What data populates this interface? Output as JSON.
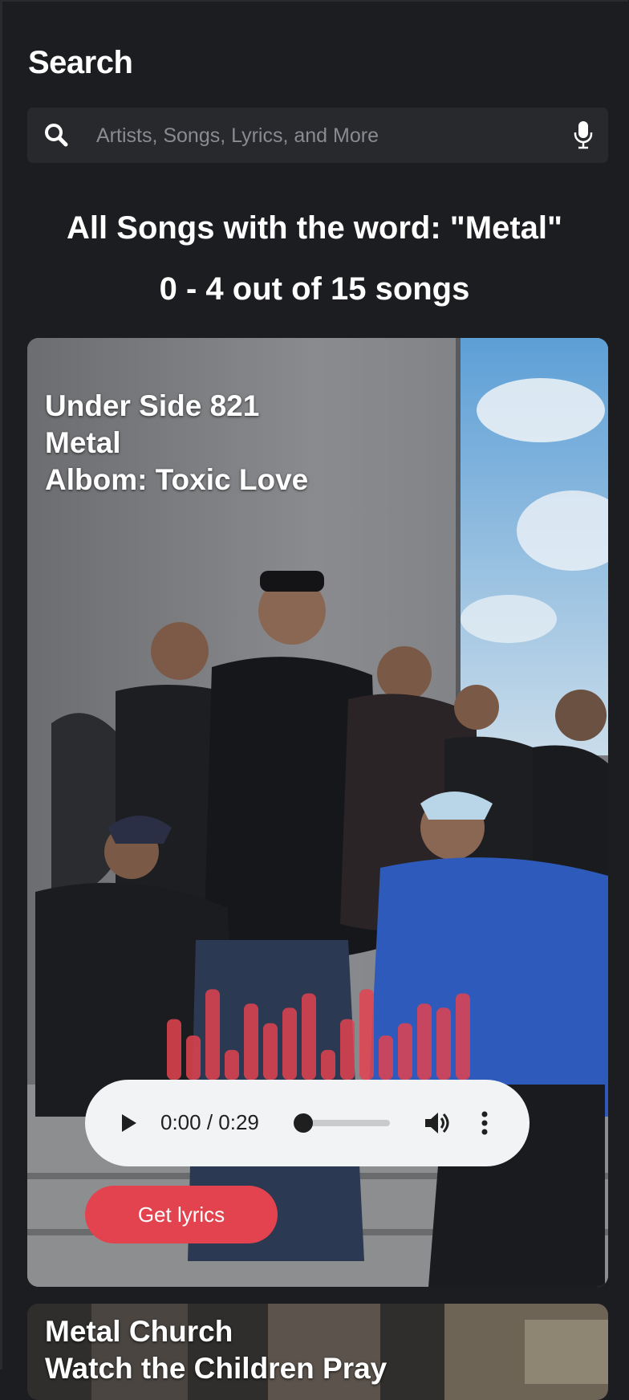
{
  "header": {
    "title": "Search"
  },
  "search": {
    "placeholder": "Artists, Songs, Lyrics, and More"
  },
  "results": {
    "heading": "All Songs with the word: \"Metal\"",
    "count": "0 - 4 out of 15 songs"
  },
  "songs": [
    {
      "artist": "Under Side 821",
      "title": "Metal",
      "album": "Albom: Toxic Love",
      "player": {
        "time": "0:00 / 0:29",
        "progress": 0
      },
      "lyrics_button": "Get lyrics",
      "visualizer_levels": [
        0.59,
        0.43,
        0.88,
        0.29,
        0.74,
        0.55,
        0.7,
        0.84,
        0.29,
        0.59,
        0.88,
        0.43,
        0.55,
        0.74,
        0.7,
        0.84
      ],
      "visualizer_color": "#e2434f"
    },
    {
      "artist": "Metal Church",
      "title": "Watch the Children Pray"
    }
  ],
  "colors": {
    "background": "#1c1d20",
    "search_bg": "#28292d",
    "accent": "#e2434f",
    "player_bg": "#f1f3f4"
  }
}
